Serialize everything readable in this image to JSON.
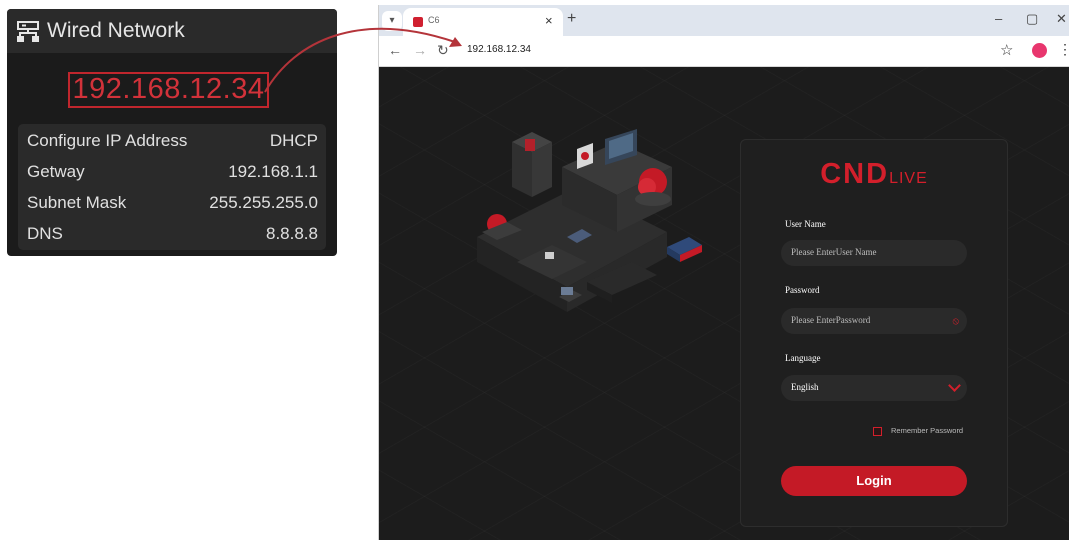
{
  "device": {
    "title": "Wired Network",
    "ip_address": "192.168.12.34",
    "rows": [
      {
        "label": "Configure IP Address",
        "value": "DHCP"
      },
      {
        "label": "Getway",
        "value": "192.168.1.1"
      },
      {
        "label": "Subnet Mask",
        "value": "255.255.255.0"
      },
      {
        "label": "DNS",
        "value": "8.8.8.8"
      }
    ]
  },
  "browser": {
    "tab_title": "C6",
    "tab_dropdown_icon": "chevron-down-icon",
    "new_tab_label": "+",
    "close_tab_label": "×",
    "window_controls": {
      "minimize": "–",
      "maximize": "▢",
      "close": "✕"
    },
    "nav": {
      "back": "←",
      "forward": "→",
      "reload": "↻"
    },
    "url": "192.168.12.34",
    "bookmark_icon": "☆",
    "menu_icon": "⋮"
  },
  "login": {
    "logo_main": "CND",
    "logo_sub": "LIVE",
    "username_label": "User Name",
    "username_placeholder": "Please EnterUser Name",
    "password_label": "Password",
    "password_placeholder": "Please EnterPassword",
    "language_label": "Language",
    "language_value": "English",
    "remember_label": "Remember Password",
    "login_button": "Login"
  },
  "colors": {
    "accent_red": "#c41a26",
    "panel_dark": "#1b1b1b",
    "ip_red": "#d2323a"
  }
}
